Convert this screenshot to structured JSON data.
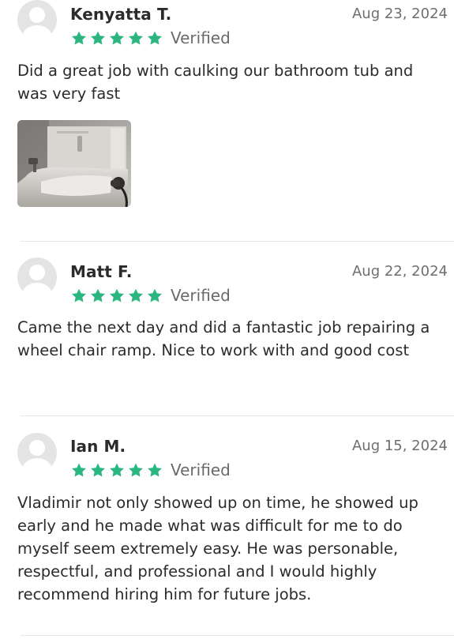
{
  "reviews": [
    {
      "name": "Kenyatta T.",
      "date": "Aug 23, 2024",
      "stars": 5,
      "verified": "Verified",
      "text": "Did a great job with caulking our bathroom tub and was very fast",
      "has_photo": true
    },
    {
      "name": "Matt F.",
      "date": "Aug 22, 2024",
      "stars": 5,
      "verified": "Verified",
      "text": "Came the next day and did a fantastic job repairing a wheel chair ramp. Nice to work with and good cost",
      "has_photo": false
    },
    {
      "name": "Ian M.",
      "date": "Aug 15, 2024",
      "stars": 5,
      "verified": "Verified",
      "text": "Vladimir not only showed up on time, he showed up early and he made what was difficult for me to do myself seem extremely easy. He was personable, respectful, and professional and I would highly recommend hiring him for future jobs.",
      "has_photo": false
    }
  ],
  "colors": {
    "star": "#2bb57f",
    "divider": "#e6e6e6",
    "avatar_bg": "#e4e4e4"
  },
  "icons": {
    "avatar": "default-user-avatar-icon",
    "star": "star-icon"
  }
}
